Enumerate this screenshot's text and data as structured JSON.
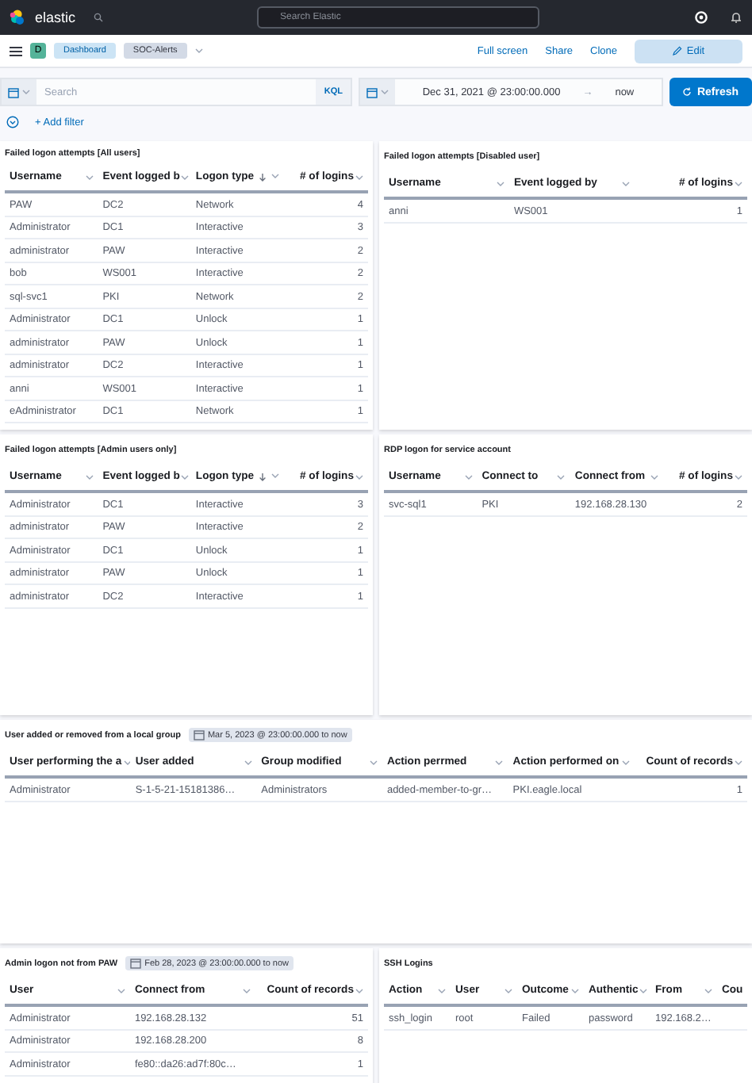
{
  "header": {
    "logo": "elastic",
    "search": {
      "placeholder": "Search Elastic"
    }
  },
  "nav": {
    "avatar": "D",
    "breadcrumbs": [
      {
        "label": "Dashboard",
        "selected": false
      },
      {
        "label": "SOC-Alerts",
        "selected": true
      }
    ],
    "actions": [
      "Full screen",
      "Share",
      "Clone"
    ],
    "edit_button": "Edit"
  },
  "query_bar": {
    "search": {
      "placeholder": "Search"
    },
    "language": "KQL",
    "start": "Dec 31, 2021 @ 23:00:00.000",
    "arrow": "→",
    "end": "now",
    "refresh_button": "Refresh"
  },
  "filter_bar": {
    "add_filter": "+ Add filter"
  },
  "dashboard_rows": [
    {
      "panels": [
        {
          "title": "Failed logon attempts [All users]",
          "columns": [
            {
              "label": "Username",
              "kind": "text",
              "sorted": false
            },
            {
              "label": "Event logged b",
              "kind": "text",
              "sorted": false
            },
            {
              "label": "Logon type",
              "kind": "text",
              "sorted": true
            },
            {
              "label": "# of logins",
              "kind": "number",
              "sorted": false
            }
          ],
          "rows": [
            [
              "PAW",
              "DC2",
              "Network",
              "4"
            ],
            [
              "Administrator",
              "DC1",
              "Interactive",
              "3"
            ],
            [
              "administrator",
              "PAW",
              "Interactive",
              "2"
            ],
            [
              "bob",
              "WS001",
              "Interactive",
              "2"
            ],
            [
              "sql-svc1",
              "PKI",
              "Network",
              "2"
            ],
            [
              "Administrator",
              "DC1",
              "Unlock",
              "1"
            ],
            [
              "administrator",
              "PAW",
              "Unlock",
              "1"
            ],
            [
              "administrator",
              "DC2",
              "Interactive",
              "1"
            ],
            [
              "anni",
              "WS001",
              "Interactive",
              "1"
            ],
            [
              "eAdministrator",
              "DC1",
              "Network",
              "1"
            ]
          ]
        },
        {
          "title": "Failed logon attempts [Disabled user]",
          "columns": [
            {
              "label": "Username",
              "kind": "text",
              "sorted": false
            },
            {
              "label": "Event logged by",
              "kind": "text",
              "sorted": false
            },
            {
              "label": "# of logins",
              "kind": "number",
              "sorted": false
            }
          ],
          "rows": [
            [
              "anni",
              "WS001",
              "1"
            ]
          ]
        }
      ]
    },
    {
      "panels": [
        {
          "title": "Failed logon attempts [Admin users only]",
          "columns": [
            {
              "label": "Username",
              "kind": "text",
              "sorted": false
            },
            {
              "label": "Event logged b",
              "kind": "text",
              "sorted": false
            },
            {
              "label": "Logon type",
              "kind": "text",
              "sorted": true
            },
            {
              "label": "# of logins",
              "kind": "number",
              "sorted": false
            }
          ],
          "rows": [
            [
              "Administrator",
              "DC1",
              "Interactive",
              "3"
            ],
            [
              "administrator",
              "PAW",
              "Interactive",
              "2"
            ],
            [
              "Administrator",
              "DC1",
              "Unlock",
              "1"
            ],
            [
              "administrator",
              "PAW",
              "Unlock",
              "1"
            ],
            [
              "administrator",
              "DC2",
              "Interactive",
              "1"
            ]
          ]
        },
        {
          "title": "RDP logon for service account",
          "columns": [
            {
              "label": "Username",
              "kind": "text",
              "sorted": false
            },
            {
              "label": "Connect to",
              "kind": "text",
              "sorted": false
            },
            {
              "label": "Connect from",
              "kind": "text",
              "sorted": false
            },
            {
              "label": "# of logins",
              "kind": "number",
              "sorted": false
            }
          ],
          "rows": [
            [
              "svc-sql1",
              "PKI",
              "192.168.28.130",
              "2"
            ]
          ]
        }
      ]
    },
    {
      "panels": [
        {
          "title": "User added or removed from a local group",
          "time_badge": "Mar 5, 2023 @ 23:00:00.000 to now",
          "columns": [
            {
              "label": "User performing the a",
              "kind": "text",
              "sorted": false
            },
            {
              "label": "User added",
              "kind": "text",
              "sorted": false
            },
            {
              "label": "Group modified",
              "kind": "text",
              "sorted": false
            },
            {
              "label": "Action perrmed",
              "kind": "text",
              "sorted": false
            },
            {
              "label": "Action performed on",
              "kind": "text",
              "sorted": false
            },
            {
              "label": "Count of records",
              "kind": "number",
              "sorted": false
            }
          ],
          "rows": [
            [
              "Administrator",
              "S-1-5-21-15181386…",
              "Administrators",
              "added-member-to-gr…",
              "PKI.eagle.local",
              "1"
            ]
          ]
        }
      ]
    },
    {
      "panels": [
        {
          "title": "Admin logon not from PAW",
          "time_badge": "Feb 28, 2023 @ 23:00:00.000 to now",
          "columns": [
            {
              "label": "User",
              "kind": "text",
              "sorted": false
            },
            {
              "label": "Connect from",
              "kind": "text",
              "sorted": false
            },
            {
              "label": "Count of records",
              "kind": "number",
              "sorted": false
            }
          ],
          "rows": [
            [
              "Administrator",
              "192.168.28.132",
              "51"
            ],
            [
              "Administrator",
              "192.168.28.200",
              "8"
            ],
            [
              "Administrator",
              "fe80::da26:ad7f:80c…",
              "1"
            ]
          ]
        },
        {
          "title": "SSH Logins",
          "columns": [
            {
              "label": "Action",
              "kind": "text",
              "sorted": false
            },
            {
              "label": "User",
              "kind": "text",
              "sorted": false
            },
            {
              "label": "Outcome",
              "kind": "text",
              "sorted": false
            },
            {
              "label": "Authentic",
              "kind": "text",
              "sorted": false
            },
            {
              "label": "From",
              "kind": "text",
              "sorted": false
            },
            {
              "label": "Cou",
              "kind": "cut",
              "sorted": false
            }
          ],
          "rows": [
            [
              "ssh_login",
              "root",
              "Failed",
              "password",
              "192.168.2…"
            ]
          ]
        }
      ]
    }
  ]
}
